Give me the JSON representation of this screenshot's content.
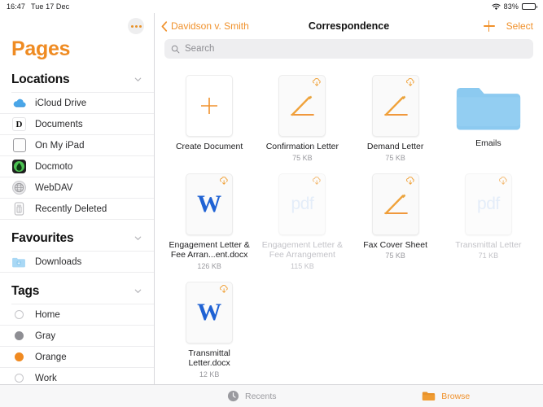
{
  "statusbar": {
    "time": "16:47",
    "date": "Tue 17 Dec",
    "wifi_icon": "wifi-icon",
    "battery_percent": "83%",
    "battery_level": 83
  },
  "sidebar": {
    "more_button_icon": "ellipsis-icon",
    "app_title": "Pages",
    "sections": [
      {
        "title": "Locations",
        "chevron_icon": "chevron-down-icon",
        "items": [
          {
            "label": "iCloud Drive",
            "icon": "icloud-icon"
          },
          {
            "label": "Documents",
            "icon": "documents-app-icon",
            "glyph": "D"
          },
          {
            "label": "On My iPad",
            "icon": "ipad-icon"
          },
          {
            "label": "Docmoto",
            "icon": "docmoto-app-icon"
          },
          {
            "label": "WebDAV",
            "icon": "globe-icon"
          },
          {
            "label": "Recently Deleted",
            "icon": "trash-icon"
          }
        ]
      },
      {
        "title": "Favourites",
        "chevron_icon": "chevron-down-icon",
        "items": [
          {
            "label": "Downloads",
            "icon": "downloads-folder-icon"
          }
        ]
      },
      {
        "title": "Tags",
        "chevron_icon": "chevron-down-icon",
        "items": [
          {
            "label": "Home",
            "icon": "tag-dot-icon",
            "color": "#ffffff"
          },
          {
            "label": "Gray",
            "icon": "tag-dot-icon",
            "color": "#8e8e93"
          },
          {
            "label": "Orange",
            "icon": "tag-dot-icon",
            "color": "#f08a21"
          },
          {
            "label": "Work",
            "icon": "tag-dot-icon",
            "color": "#ffffff"
          },
          {
            "label": "",
            "icon": "tag-dot-icon",
            "color": "#3ec454"
          }
        ]
      }
    ]
  },
  "navbar": {
    "back_label": "Davidson v. Smith",
    "back_icon": "chevron-left-icon",
    "title": "Correspondence",
    "add_icon": "plus-icon",
    "select_label": "Select"
  },
  "search": {
    "icon": "search-icon",
    "placeholder": "Search",
    "value": ""
  },
  "files": [
    {
      "name": "Create Document",
      "size": "",
      "kind": "new",
      "icon": "plus-icon",
      "cloud": false,
      "dimmed": false
    },
    {
      "name": "Confirmation Letter",
      "size": "75 KB",
      "kind": "pages",
      "icon": "pages-document-icon",
      "cloud": true,
      "dimmed": false
    },
    {
      "name": "Demand Letter",
      "size": "75 KB",
      "kind": "pages",
      "icon": "pages-document-icon",
      "cloud": true,
      "dimmed": false
    },
    {
      "name": "Emails",
      "size": "",
      "kind": "folder",
      "icon": "folder-icon",
      "cloud": false,
      "dimmed": false
    },
    {
      "name": "Engagement Letter & Fee Arran...ent.docx",
      "size": "126 KB",
      "kind": "docx",
      "icon": "word-document-icon",
      "cloud": true,
      "dimmed": false
    },
    {
      "name": "Engagement Letter & Fee Arrangement",
      "size": "115 KB",
      "kind": "pdf",
      "icon": "pdf-document-icon",
      "cloud": true,
      "dimmed": true
    },
    {
      "name": "Fax Cover Sheet",
      "size": "75 KB",
      "kind": "pages",
      "icon": "pages-document-icon",
      "cloud": true,
      "dimmed": false
    },
    {
      "name": "Transmittal Letter",
      "size": "71 KB",
      "kind": "pdf",
      "icon": "pdf-document-icon",
      "cloud": true,
      "dimmed": true
    },
    {
      "name": "Transmittal Letter.docx",
      "size": "12 KB",
      "kind": "docx",
      "icon": "word-document-icon",
      "cloud": true,
      "dimmed": false
    }
  ],
  "tabbar": {
    "recents_label": "Recents",
    "recents_icon": "clock-icon",
    "browse_label": "Browse",
    "browse_icon": "folder-icon",
    "active": "Browse"
  },
  "colors": {
    "accent": "#f0912b",
    "pages_title": "#ef8b22",
    "folder_blue": "#8ccaf0",
    "word_blue": "#1f62d4",
    "pdf_blue": "#a8c8ee",
    "tag_gray": "#8e8e93",
    "tag_orange": "#f08a21",
    "tag_green": "#3ec454"
  }
}
